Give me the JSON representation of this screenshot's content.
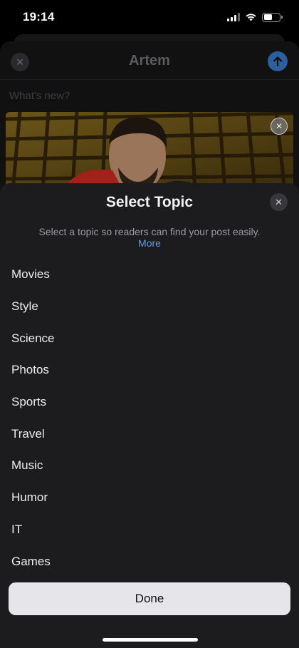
{
  "status_bar": {
    "time": "19:14",
    "battery_level": 0.55
  },
  "composer": {
    "title": "Artem",
    "placeholder": "What's new?",
    "accent_color": "#2d5f9e",
    "photo_icon": "person-photo"
  },
  "topic_sheet": {
    "title": "Select Topic",
    "subtitle": "Select a topic so readers can find your post easily.",
    "more_label": "More",
    "topics": [
      "Movies",
      "Style",
      "Science",
      "Photos",
      "Sports",
      "Travel",
      "Music",
      "Humor",
      "IT",
      "Games"
    ],
    "done_label": "Done",
    "link_color": "#5a9eea"
  }
}
